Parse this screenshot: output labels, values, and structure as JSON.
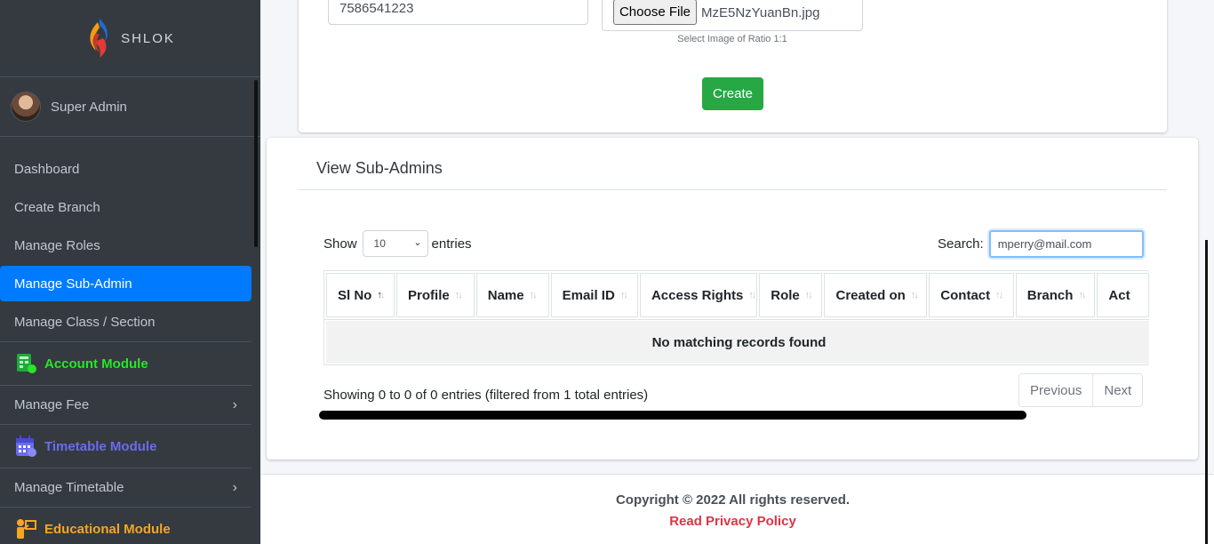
{
  "brand": {
    "name": "SHLOK"
  },
  "user": {
    "name": "Super Admin"
  },
  "sidebar": {
    "items": [
      {
        "label": "Dashboard"
      },
      {
        "label": "Create Branch"
      },
      {
        "label": "Manage Roles"
      },
      {
        "label": "Manage Sub-Admin",
        "active": true
      },
      {
        "label": "Manage Class / Section"
      }
    ],
    "modules": [
      {
        "label": "Account Module",
        "color": "#28e528",
        "icon": "account-module-icon"
      },
      {
        "label": "Timetable Module",
        "color": "#6b6bf0",
        "icon": "calendar-icon"
      },
      {
        "label": "Educational Module",
        "color": "#f5a623",
        "icon": "teacher-icon"
      }
    ],
    "sub_items": [
      {
        "label": "Manage Fee"
      },
      {
        "label": "Manage Timetable"
      }
    ]
  },
  "form": {
    "phone_value": "7586541223",
    "file_button": "Choose File",
    "file_name": "MzE5NzYuanBn.jpg",
    "file_hint": "Select Image of Ratio 1:1",
    "create_label": "Create"
  },
  "list": {
    "title": "View Sub-Admins",
    "show_label": "Show",
    "entries_label": "entries",
    "page_size": "10",
    "search_label": "Search:",
    "search_value": "mperry@mail.com",
    "columns": [
      {
        "label": "Sl No",
        "sorted": "asc"
      },
      {
        "label": "Profile"
      },
      {
        "label": "Name"
      },
      {
        "label": "Email ID"
      },
      {
        "label": "Access Rights"
      },
      {
        "label": "Role"
      },
      {
        "label": "Created on"
      },
      {
        "label": "Contact"
      },
      {
        "label": "Branch"
      },
      {
        "label": "Act"
      }
    ],
    "empty_message": "No matching records found",
    "info": "Showing 0 to 0 of 0 entries (filtered from 1 total entries)",
    "prev_label": "Previous",
    "next_label": "Next"
  },
  "footer": {
    "copyright": "Copyright © 2022 All rights reserved.",
    "privacy": "Read Privacy Policy"
  },
  "colors": {
    "sidebar": "#343a40",
    "active": "#007bff",
    "create": "#28a745",
    "privacy": "#dc3545"
  }
}
